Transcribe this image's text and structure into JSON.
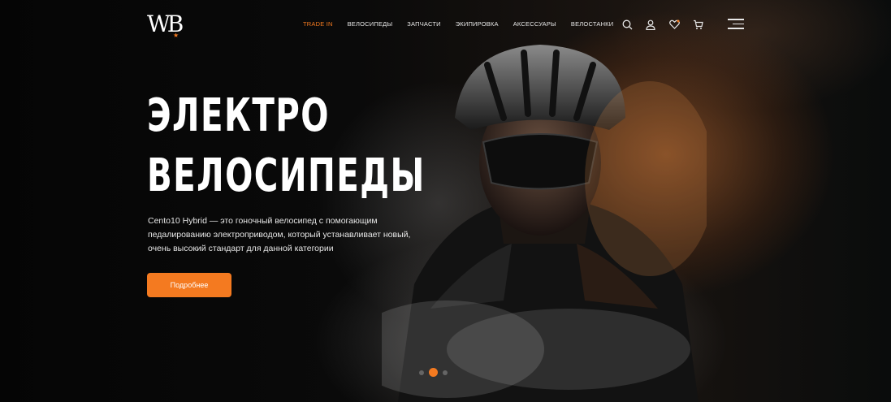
{
  "header": {
    "logo_text": "WB",
    "nav": [
      {
        "label": "TRADE IN",
        "active": true
      },
      {
        "label": "ВЕЛОСИПЕДЫ",
        "active": false
      },
      {
        "label": "ЗАПЧАСТИ",
        "active": false
      },
      {
        "label": "ЭКИПИРОВКА",
        "active": false
      },
      {
        "label": "АКСЕССУАРЫ",
        "active": false
      },
      {
        "label": "ВЕЛОСТАНКИ",
        "active": false
      }
    ],
    "icons": [
      "search-icon",
      "user-icon",
      "heart-icon",
      "cart-icon",
      "menu-icon"
    ]
  },
  "hero": {
    "title_line1": "ЭЛЕКТРО",
    "title_line2": "ВЕЛОСИПЕДЫ",
    "description": "Cento10 Hybrid — это гоночный велосипед с помогающим педалированию электроприводом, который устанавливает новый, очень высокий стандарт для данной категории",
    "cta_label": "Подробнее",
    "slides_total": 3,
    "slide_active": 2
  },
  "colors": {
    "accent": "#f47a20",
    "background": "#050505",
    "text": "#ffffff"
  }
}
